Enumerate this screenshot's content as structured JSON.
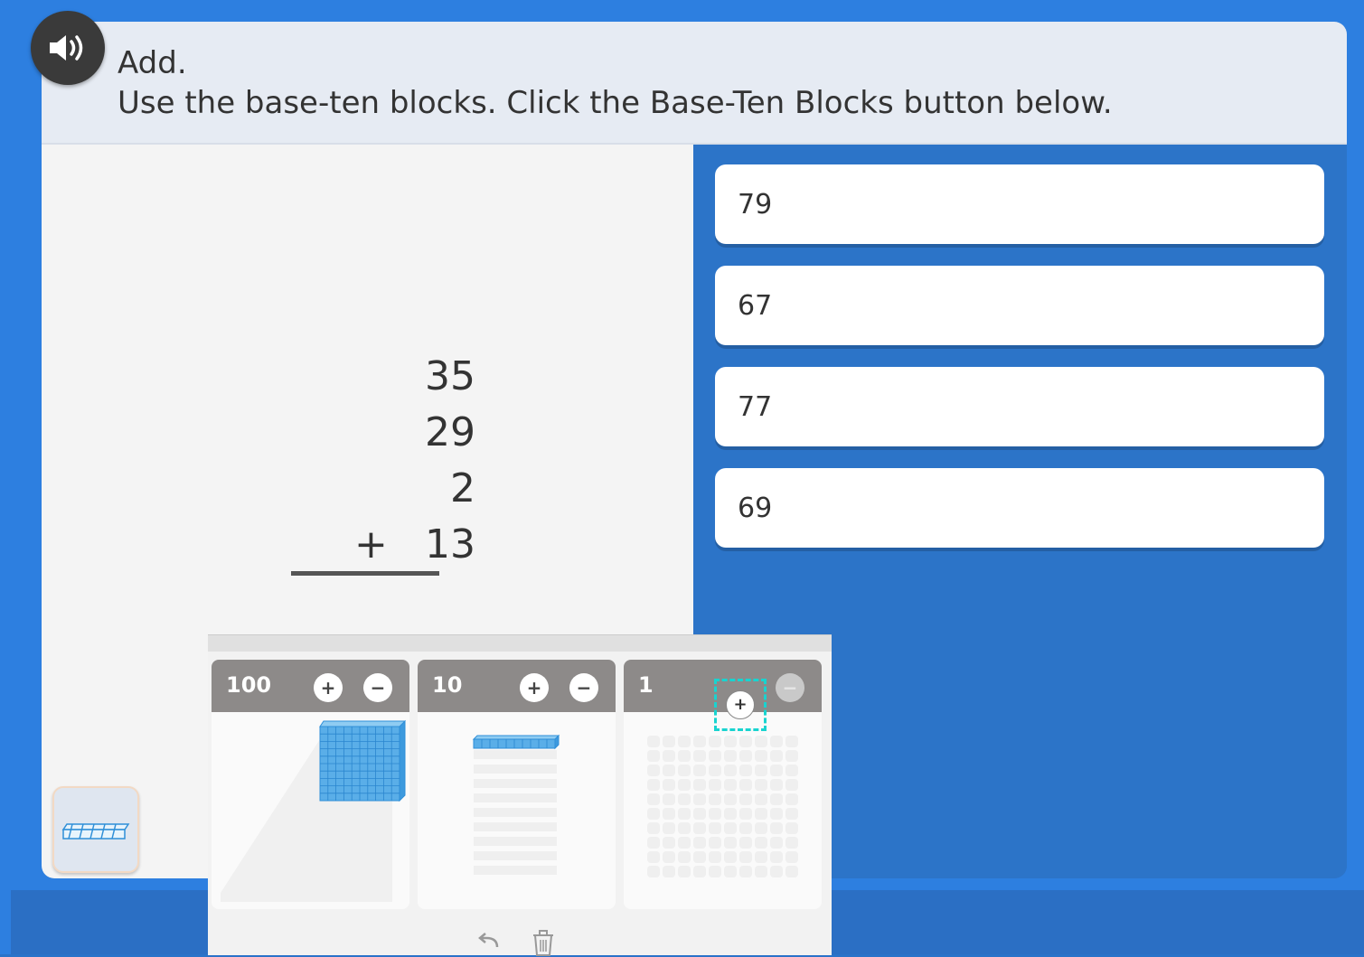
{
  "prompt": {
    "title": "Add.",
    "instruction": "Use the base-ten blocks. Click the Base-Ten Blocks button below."
  },
  "problem": {
    "addends": [
      "35",
      "29",
      "2",
      "13"
    ],
    "operator": "+"
  },
  "choices": [
    "79",
    "67",
    "77",
    "69"
  ],
  "blocks_panel": {
    "columns": [
      {
        "label": "100",
        "plus": "+",
        "minus": "−"
      },
      {
        "label": "10",
        "plus": "+",
        "minus": "−"
      },
      {
        "label": "1",
        "plus": "+",
        "minus": "−"
      }
    ]
  },
  "colors": {
    "accent_blue": "#2d7fe0",
    "block_blue": "#5aaee8",
    "highlight": "#18d4d0"
  }
}
